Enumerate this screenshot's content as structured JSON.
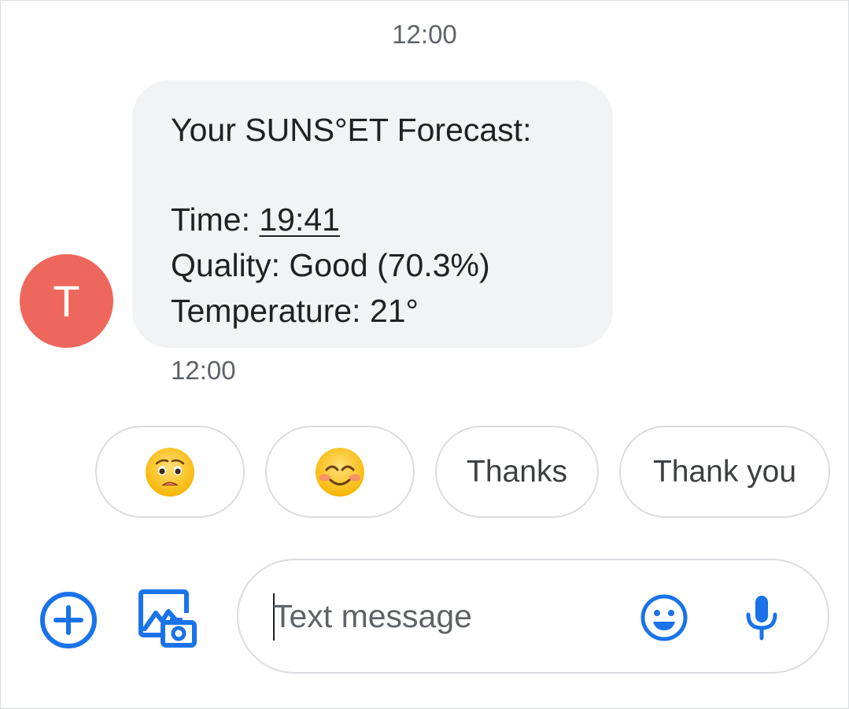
{
  "header": {
    "time": "12:00"
  },
  "sender": {
    "avatar_letter": "T",
    "avatar_color": "#ee675c"
  },
  "message": {
    "title": "Your SUNS°ET Forecast:",
    "time_label": "Time: ",
    "time_value": "19:41",
    "quality": "Quality: Good (70.3%)",
    "temperature": "Temperature: 21°",
    "timestamp": "12:00"
  },
  "smart_replies": {
    "chip1_icon": "worried-face-emoji",
    "chip2_icon": "smiling-face-emoji",
    "chip3_label": "Thanks",
    "chip4_label": "Thank you"
  },
  "composer": {
    "placeholder": "Text message",
    "add_icon": "add-circle-icon",
    "gallery_icon": "gallery-camera-icon",
    "emoji_icon": "emoji-icon",
    "mic_icon": "microphone-icon",
    "accent": "#1a73e8"
  }
}
